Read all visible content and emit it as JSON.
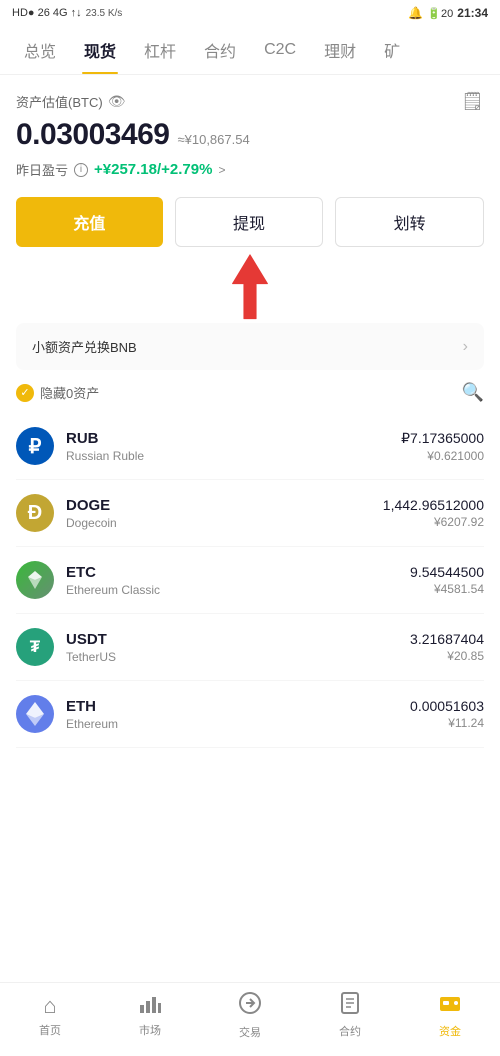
{
  "statusBar": {
    "left": "HD● 26 46 ☁ ▲▼",
    "network": "23.5 K/s",
    "time": "21:34",
    "batteryLabel": "20"
  },
  "nav": {
    "tabs": [
      {
        "label": "总览",
        "active": false
      },
      {
        "label": "现货",
        "active": true
      },
      {
        "label": "杠杆",
        "active": false
      },
      {
        "label": "合约",
        "active": false
      },
      {
        "label": "C2C",
        "active": false
      },
      {
        "label": "理财",
        "active": false
      },
      {
        "label": "矿",
        "active": false
      }
    ]
  },
  "asset": {
    "label": "资产估值(BTC)",
    "btcValue": "0.03003469",
    "cnyApprox": "≈¥10,867.54",
    "pnlLabel": "昨日盈亏",
    "pnlValue": "+¥257.18/+2.79%",
    "pnlArrow": ">"
  },
  "buttons": {
    "deposit": "充值",
    "withdraw": "提现",
    "transfer": "划转"
  },
  "smallAssets": {
    "text": "小额资产兑换BNB"
  },
  "assetList": {
    "hideZeroLabel": "隐藏0资产",
    "coins": [
      {
        "symbol": "RUB",
        "name": "Russian Ruble",
        "balance": "₽7.17365000",
        "cny": "¥0.621000",
        "colorClass": "rub",
        "iconText": "₽"
      },
      {
        "symbol": "DOGE",
        "name": "Dogecoin",
        "balance": "1,442.96512000",
        "cny": "¥6207.92",
        "colorClass": "doge",
        "iconText": "Ð"
      },
      {
        "symbol": "ETC",
        "name": "Ethereum Classic",
        "balance": "9.54544500",
        "cny": "¥4581.54",
        "colorClass": "etc",
        "iconText": "◆"
      },
      {
        "symbol": "USDT",
        "name": "TetherUS",
        "balance": "3.21687404",
        "cny": "¥20.85",
        "colorClass": "usdt",
        "iconText": "₮"
      },
      {
        "symbol": "ETH",
        "name": "Ethereum",
        "balance": "0.00051603",
        "cny": "¥11.24",
        "colorClass": "eth",
        "iconText": "Ξ"
      }
    ]
  },
  "bottomNav": {
    "items": [
      {
        "label": "首页",
        "active": false,
        "icon": "⌂"
      },
      {
        "label": "市场",
        "active": false,
        "icon": "📊"
      },
      {
        "label": "交易",
        "active": false,
        "icon": "🔄"
      },
      {
        "label": "合约",
        "active": false,
        "icon": "📋"
      },
      {
        "label": "资金",
        "active": true,
        "icon": "💼"
      }
    ]
  }
}
